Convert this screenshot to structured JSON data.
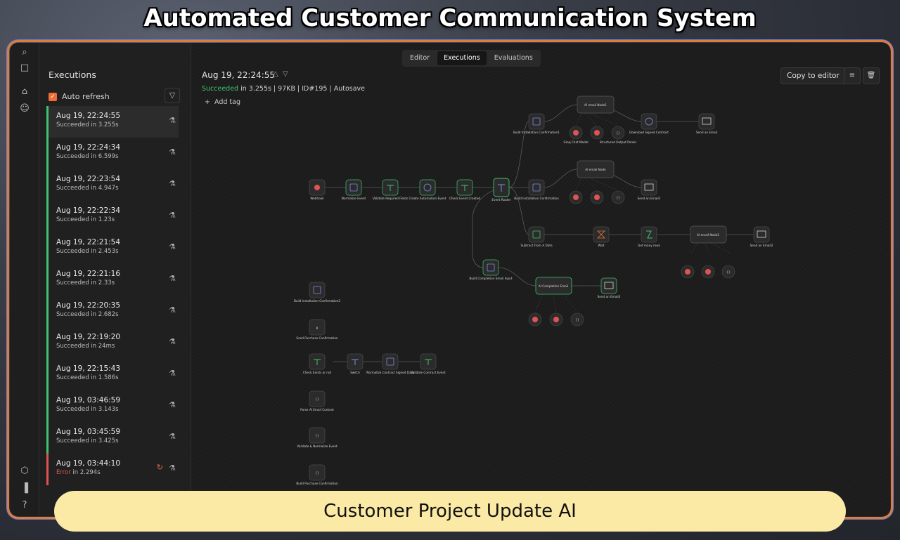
{
  "banner": {
    "title": "Automated Customer Communication System",
    "footer": "Customer Project Update AI"
  },
  "tabs": [
    "Editor",
    "Executions",
    "Evaluations"
  ],
  "sidebar": {
    "title": "Executions",
    "auto_refresh": "Auto refresh",
    "items": [
      {
        "time": "Aug 19, 22:24:55",
        "status": "Succeeded in 3.255s",
        "state": "success"
      },
      {
        "time": "Aug 19, 22:24:34",
        "status": "Succeeded in 6.599s",
        "state": "success"
      },
      {
        "time": "Aug 19, 22:23:54",
        "status": "Succeeded in 4.947s",
        "state": "success"
      },
      {
        "time": "Aug 19, 22:22:34",
        "status": "Succeeded in 1.23s",
        "state": "success"
      },
      {
        "time": "Aug 19, 22:21:54",
        "status": "Succeeded in 2.453s",
        "state": "success"
      },
      {
        "time": "Aug 19, 22:21:16",
        "status": "Succeeded in 2.33s",
        "state": "success"
      },
      {
        "time": "Aug 19, 22:20:35",
        "status": "Succeeded in 2.682s",
        "state": "success"
      },
      {
        "time": "Aug 19, 22:19:20",
        "status": "Succeeded in 24ms",
        "state": "success"
      },
      {
        "time": "Aug 19, 22:15:43",
        "status": "Succeeded in 1.586s",
        "state": "success"
      },
      {
        "time": "Aug 19, 03:46:59",
        "status": "Succeeded in 3.143s",
        "state": "success"
      },
      {
        "time": "Aug 19, 03:45:59",
        "status": "Succeeded in 3.425s",
        "state": "success"
      },
      {
        "time": "Aug 19, 03:44:10",
        "status_prefix": "Error",
        "status_suffix": " in 2.294s",
        "state": "error"
      }
    ]
  },
  "execution": {
    "timestamp": "Aug 19, 22:24:55",
    "succeeded": "Succeeded",
    "meta": " in 3.255s | 97KB | ID#195 | Autosave",
    "add_tag": "Add tag",
    "copy_to_editor": "Copy to editor"
  },
  "nodes": {
    "webhook": "Webhook",
    "normalize_event": "Normalize Event",
    "validate_required": "Validate Required Fields",
    "create_automation_event": "Create Automation Event",
    "check_event_created": "Check Event Created",
    "event_router": "Event Router",
    "build_installation_confirmation1": "Build Installation Confirmation1",
    "ai_email_node1": "AI email Node1",
    "download_signed_contract": "Download Signed Contract",
    "send_an_email": "Send an Email",
    "build_installation_confirmation": "Build Installation Confirmation",
    "ai_email_node": "AI email Node",
    "send_an_email1": "Send an Email1",
    "subtract_from_a_date": "Subtract From A Date",
    "wait": "Wait",
    "get_many_rows": "Get many rows",
    "ai_email_node2": "AI email Node2",
    "send_an_email2": "Send an Email2",
    "build_completion_email_input": "Build Completion Email Input",
    "ai_completion_email": "AI Completion Email",
    "send_an_email3": "Send an Email3",
    "build_installation_confirmation2": "Build Installation Confirmation2",
    "send_purchase_confirmation": "Send Purchase Confirmation",
    "check_exists_or_not": "Check Exists or not",
    "switch": "Switch",
    "normalize_contract_signed_data": "Normalize Contract Signed Data",
    "validate_contract_event": "Validate Contract Event",
    "parse_ai_email_content": "Parse AI Email Content",
    "validate_normalize_event": "Validate & Normalize Event",
    "build_purchase_confirmation": "Build Purchase Confirmation",
    "groq_chat_model": "Groq Chat Model",
    "structured_output_parser": "Structured Output Parser"
  },
  "colors": {
    "accent": "#ef6c35",
    "success": "#3ec46d",
    "error": "#e05353",
    "footer_bg": "#fbe9a6"
  }
}
